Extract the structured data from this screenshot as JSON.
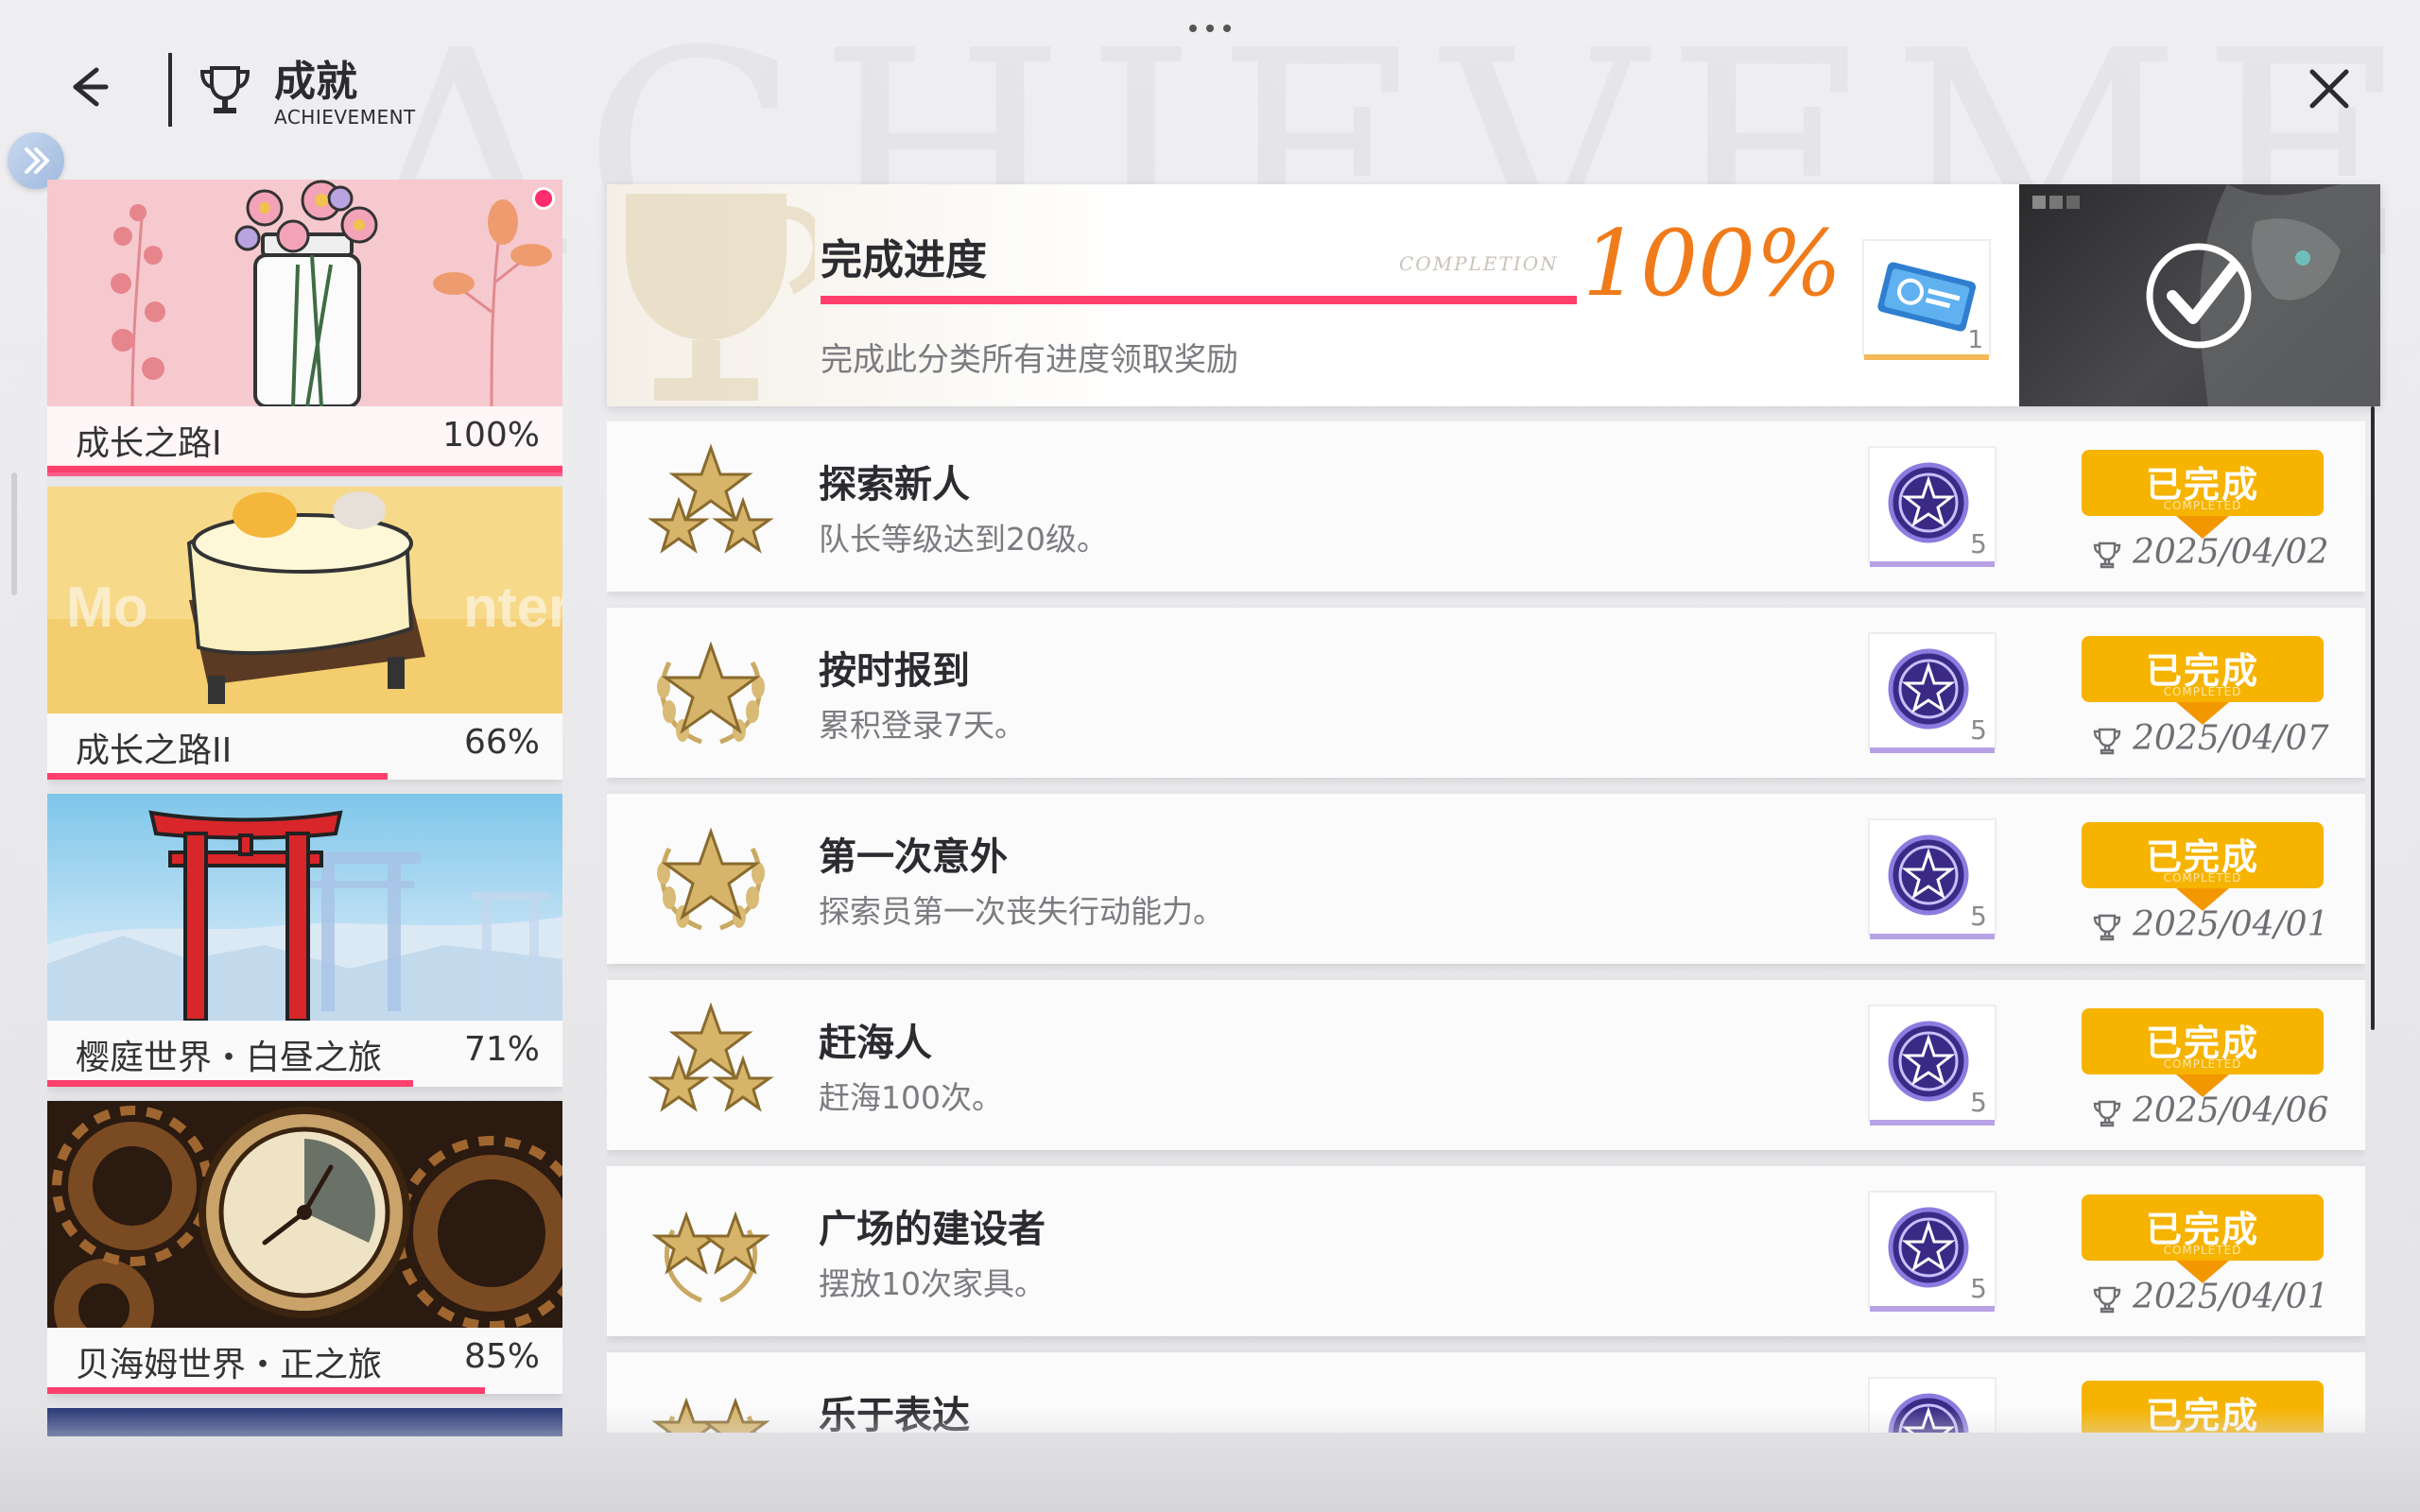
{
  "header": {
    "title_zh": "成就",
    "title_en": "ACHIEVEMENT",
    "watermark": "ACHIEVEMENT"
  },
  "categories": [
    {
      "name": "成长之路I",
      "percent": "100%",
      "progress": 1.0,
      "active": true,
      "art": "flowers"
    },
    {
      "name": "成长之路II",
      "percent": "66%",
      "progress": 0.66,
      "active": false,
      "art": "cake"
    },
    {
      "name": "樱庭世界・白昼之旅",
      "percent": "71%",
      "progress": 0.71,
      "active": false,
      "art": "torii"
    },
    {
      "name": "贝海姆世界・正之旅",
      "percent": "85%",
      "progress": 0.85,
      "active": false,
      "art": "clock"
    }
  ],
  "summary": {
    "title": "完成进度",
    "completion_label": "COMPLETION",
    "percent": "100%",
    "progress": 1.0,
    "description": "完成此分类所有进度领取奖励",
    "reward": {
      "icon": "ticket-icon",
      "count": "1"
    }
  },
  "achievements": [
    {
      "title": "探索新人",
      "desc": "队长等级达到20级。",
      "reward_count": "5",
      "status": "已完成",
      "status_sub": "COMPLETED",
      "date": "2025/04/02",
      "medal": "three-star"
    },
    {
      "title": "按时报到",
      "desc": "累积登录7天。",
      "reward_count": "5",
      "status": "已完成",
      "status_sub": "COMPLETED",
      "date": "2025/04/07",
      "medal": "one-star"
    },
    {
      "title": "第一次意外",
      "desc": "探索员第一次丧失行动能力。",
      "reward_count": "5",
      "status": "已完成",
      "status_sub": "COMPLETED",
      "date": "2025/04/01",
      "medal": "one-star"
    },
    {
      "title": "赶海人",
      "desc": "赶海100次。",
      "reward_count": "5",
      "status": "已完成",
      "status_sub": "COMPLETED",
      "date": "2025/04/06",
      "medal": "three-star"
    },
    {
      "title": "广场的建设者",
      "desc": "摆放10次家具。",
      "reward_count": "5",
      "status": "已完成",
      "status_sub": "COMPLETED",
      "date": "2025/04/01",
      "medal": "two-star"
    },
    {
      "title": "乐于表达",
      "desc": "",
      "reward_count": "",
      "status": "已完成",
      "status_sub": "",
      "date": "",
      "medal": "two-star"
    }
  ],
  "colors": {
    "accent_pink": "#ff3f6c",
    "badge_orange": "#f6b300",
    "percent_orange": "#f07b1a"
  }
}
